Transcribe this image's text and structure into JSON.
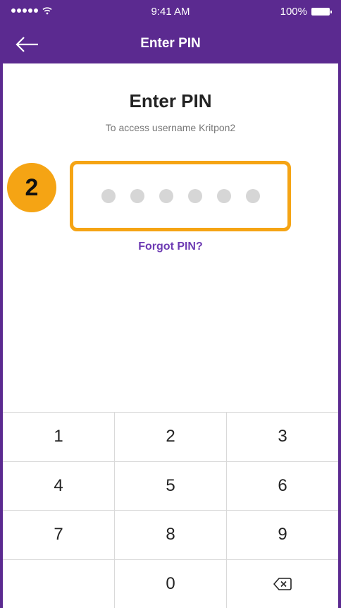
{
  "status_bar": {
    "time": "9:41 AM",
    "battery": "100%",
    "signal_icon": "signal-dots-icon",
    "wifi_icon": "wifi-icon",
    "battery_icon": "battery-icon"
  },
  "nav": {
    "title": "Enter PIN",
    "back_icon": "arrow-left-icon"
  },
  "main": {
    "heading": "Enter PIN",
    "subheading": "To access username Kritpon2",
    "step_badge": "2",
    "pin_length": 6,
    "pin_entered": 0,
    "forgot_link": "Forgot PIN?"
  },
  "keypad": {
    "keys": [
      [
        "1",
        "2",
        "3"
      ],
      [
        "4",
        "5",
        "6"
      ],
      [
        "7",
        "8",
        "9"
      ],
      [
        "",
        "0",
        "backspace"
      ]
    ],
    "backspace_icon": "backspace-icon"
  },
  "colors": {
    "brand": "#5b2a90",
    "highlight": "#f5a414",
    "link": "#6d3bb3",
    "pin_dot": "#d6d6d6"
  }
}
